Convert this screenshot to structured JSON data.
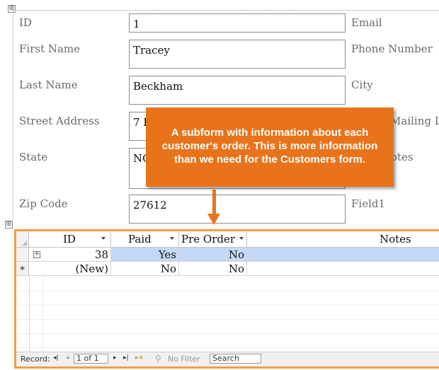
{
  "form": {
    "move_handle_glyph": "⊞",
    "labels": {
      "id": "ID",
      "first_name": "First Name",
      "last_name": "Last Name",
      "street_address": "Street Address",
      "state": "State",
      "zip_code": "Zip Code",
      "email": "Email",
      "phone_number": "Phone Number",
      "city": "City",
      "mailing_list": "Mailing Li",
      "notes": "otes",
      "field1": "Field1"
    },
    "values": {
      "id": "1",
      "first_name": "Tracey",
      "last_name": "Beckham",
      "street_address": "7 E",
      "state": "NC",
      "zip_code": "27612"
    }
  },
  "callout": {
    "text": "A subform with information about each customer's order. This is more information than we need for the Customers form.",
    "color": "#e8731a"
  },
  "subform": {
    "columns": [
      {
        "label": "ID",
        "sortable": true
      },
      {
        "label": "Paid",
        "sortable": true
      },
      {
        "label": "Pre Order",
        "sortable": true
      },
      {
        "label": "Notes",
        "sortable": false
      }
    ],
    "rows": [
      {
        "expander": "+",
        "id": "38",
        "paid": "Yes",
        "pre_order": "No",
        "notes": "",
        "selected": true
      },
      {
        "marker": "∗",
        "id": "(New)",
        "paid": "No",
        "pre_order": "No",
        "notes": "",
        "selected": false
      }
    ],
    "navigation": {
      "record_label": "Record:",
      "first_glyph": "◂|",
      "prev_glyph": "◂",
      "position": "1 of 1",
      "next_glyph": "▸",
      "last_glyph": "▸|",
      "new_glyph": "▸∗",
      "filter_label": "No Filter",
      "search_label": "Search"
    },
    "highlight_color": "#f0a040"
  }
}
